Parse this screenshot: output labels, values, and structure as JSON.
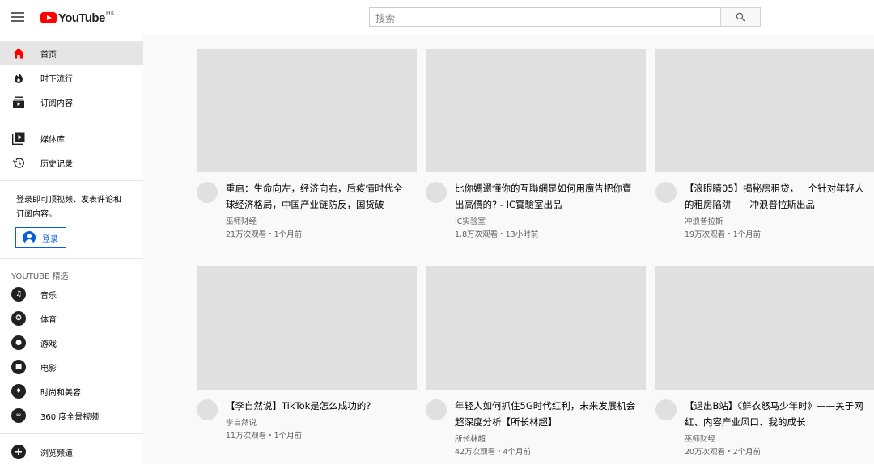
{
  "header": {
    "logo_text": "YouTube",
    "region": "HK",
    "search_placeholder": "搜索"
  },
  "sidebar": {
    "main_items": [
      {
        "label": "首页",
        "icon": "home-icon",
        "active": true
      },
      {
        "label": "时下流行",
        "icon": "flame-icon"
      },
      {
        "label": "订阅内容",
        "icon": "subscriptions-icon"
      }
    ],
    "library_items": [
      {
        "label": "媒体库",
        "icon": "library-icon"
      },
      {
        "label": "历史记录",
        "icon": "history-icon"
      }
    ],
    "signin_prompt": "登录即可顶视频、发表评论和订阅内容。",
    "signin_label": "登录",
    "best_of_title": "YOUTUBE 精选",
    "best_of_items": [
      {
        "label": "音乐",
        "icon": "music-icon"
      },
      {
        "label": "体育",
        "icon": "sports-icon"
      },
      {
        "label": "游戏",
        "icon": "gaming-icon"
      },
      {
        "label": "电影",
        "icon": "movies-icon"
      },
      {
        "label": "时尚和美容",
        "icon": "fashion-icon"
      },
      {
        "label": "360 度全景视频",
        "icon": "360-video-icon"
      }
    ],
    "browse_label": "浏览频道"
  },
  "videos": [
    {
      "title": "重启：生命向左，经济向右，后疫情时代全球经济格局，中国产业链防反，国货破",
      "channel": "巫师财经",
      "stats": "21万次观看・1个月前"
    },
    {
      "title": "比你媽還懂你的互聯網是如何用廣告把你賣出高價的? - IC實驗室出品",
      "channel": "IC实验室",
      "stats": "1.8万次观看・13小时前"
    },
    {
      "title": "【浪眼睛05】揭秘房租贷，一个针对年轻人的租房陷阱——冲浪普拉斯出品",
      "channel": "冲浪普拉斯",
      "stats": "19万次观看・1个月前"
    },
    {
      "title": "【李自然说】TikTok是怎么成功的?",
      "channel": "李自然说",
      "stats": "11万次观看・1个月前"
    },
    {
      "title": "年轻人如何抓住5G时代红利，未来发展机会超深度分析【所长林超】",
      "channel": "所长林超",
      "stats": "42万次观看・4个月前"
    },
    {
      "title": "【退出B站】《鲜衣怒马少年时》——关于网红、内容产业风口、我的成长",
      "channel": "巫师财经",
      "stats": "20万次观看・2个月前"
    }
  ]
}
